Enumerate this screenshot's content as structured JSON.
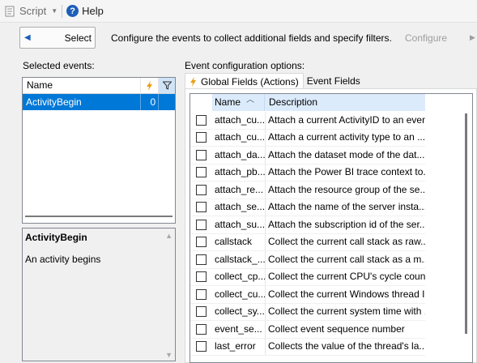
{
  "toolbar": {
    "script_label": "Script",
    "help_label": "Help"
  },
  "nav": {
    "select_label": "Select",
    "description": "Configure the events to collect additional fields and specify filters.",
    "configure_label": "Configure"
  },
  "selected_events": {
    "label": "Selected events:",
    "columns": {
      "name": "Name"
    },
    "rows": [
      {
        "name": "ActivityBegin",
        "count": "0"
      }
    ]
  },
  "description_panel": {
    "title": "ActivityBegin",
    "text": "An activity begins"
  },
  "config": {
    "label": "Event configuration options:",
    "tabs": [
      {
        "label": "Global Fields (Actions)"
      },
      {
        "label": "Event Fields"
      }
    ],
    "columns": {
      "name": "Name",
      "description": "Description"
    },
    "rows": [
      {
        "name": "attach_cu...",
        "description": "Attach a current ActivityID to an event"
      },
      {
        "name": "attach_cu...",
        "description": "Attach a current activity type to an ..."
      },
      {
        "name": "attach_da...",
        "description": "Attach the dataset mode of the dat..."
      },
      {
        "name": "attach_pb...",
        "description": "Attach the Power BI trace context to..."
      },
      {
        "name": "attach_re...",
        "description": "Attach the resource group of the se..."
      },
      {
        "name": "attach_se...",
        "description": "Attach the name of the server insta..."
      },
      {
        "name": "attach_su...",
        "description": "Attach the subscription id of the ser..."
      },
      {
        "name": "callstack",
        "description": "Collect the current call stack as raw..."
      },
      {
        "name": "callstack_...",
        "description": "Collect the current call stack as a m..."
      },
      {
        "name": "collect_cp...",
        "description": "Collect the current CPU's cycle count"
      },
      {
        "name": "collect_cu...",
        "description": "Collect the current Windows thread ID"
      },
      {
        "name": "collect_sy...",
        "description": "Collect the current system time with ..."
      },
      {
        "name": "event_se...",
        "description": "Collect event sequence number"
      },
      {
        "name": "last_error",
        "description": "Collects the value of the thread's la..."
      }
    ]
  },
  "colors": {
    "selection": "#0078d7",
    "header_highlight": "#dcebfc",
    "accent": "#1d5fb8"
  }
}
